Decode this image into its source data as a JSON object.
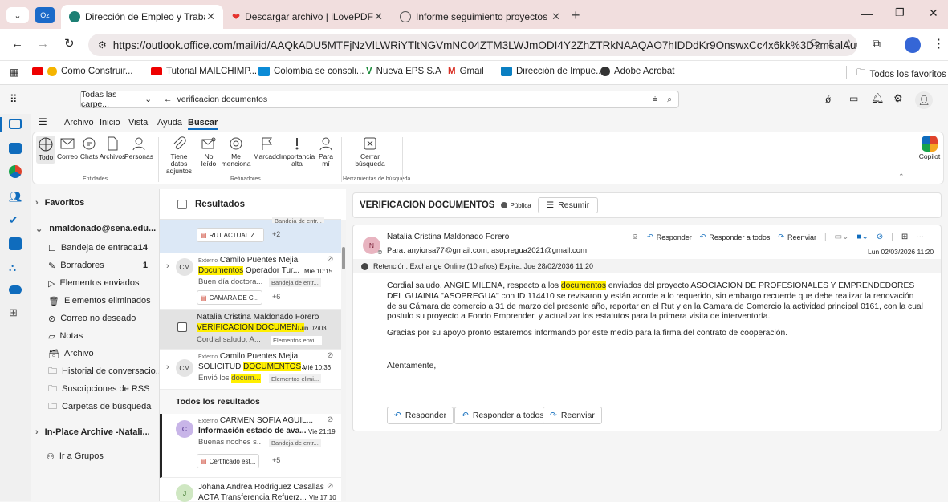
{
  "browser": {
    "tabs": [
      {
        "title": "Dirección de Empleo y Trabajo",
        "active": true
      },
      {
        "title": "Descargar archivo | iLovePDF",
        "active": false
      },
      {
        "title": "Informe seguimiento proyectos",
        "active": false
      }
    ],
    "url": "https://outlook.office.com/mail/id/AAQkADU5MTFjNzVlLWRiYTltNGVmNC04ZTM3LWJmODI4Y2ZhZTRkNAAQAO7hIDDdKr9OnswxCc4x6kk%3D?msalAuth...",
    "bookmarks": [
      "Como Construir...",
      "Tutorial MAILCHIMP...",
      "Colombia se consoli...",
      "Nueva EPS S.A",
      "Gmail",
      "Dirección de Impue...",
      "Adobe Acrobat"
    ],
    "all_bookmarks": "Todos los favoritos"
  },
  "search": {
    "scope": "Todas las carpe...",
    "query": "verificacion documentos"
  },
  "ribbon_tabs": [
    "Archivo",
    "Inicio",
    "Vista",
    "Ayuda",
    "Buscar"
  ],
  "ribbon": {
    "entidades": [
      "Todo",
      "Correo",
      "Chats",
      "Archivos",
      "Personas"
    ],
    "entidades_label": "Entidades",
    "refinadores": [
      {
        "l1": "Tiene datos",
        "l2": "adjuntos"
      },
      {
        "l1": "No",
        "l2": "leído"
      },
      {
        "l1": "Me",
        "l2": "menciona"
      },
      {
        "l1": "Marcado",
        "l2": ""
      },
      {
        "l1": "Importancia",
        "l2": "alta"
      },
      {
        "l1": "Para",
        "l2": "mí"
      }
    ],
    "refinadores_label": "Refinadores",
    "close_l1": "Cerrar",
    "close_l2": "búsqueda",
    "herramientas_label": "Herramientas de búsqueda",
    "copilot": "Copilot"
  },
  "folders": {
    "favoritos": "Favoritos",
    "account": "nmaldonado@sena.edu...",
    "items": [
      {
        "label": "Bandeja de entrada",
        "count": "14"
      },
      {
        "label": "Borradores",
        "count": "1"
      },
      {
        "label": "Elementos enviados",
        "count": ""
      },
      {
        "label": "Elementos eliminados",
        "count": ""
      },
      {
        "label": "Correo no deseado",
        "count": ""
      },
      {
        "label": "Notas",
        "count": ""
      },
      {
        "label": "Archivo",
        "count": ""
      },
      {
        "label": "Historial de conversacio...",
        "count": ""
      },
      {
        "label": "Suscripciones de RSS",
        "count": ""
      },
      {
        "label": "Carpetas de búsqueda",
        "count": ""
      }
    ],
    "archive": "In-Place Archive -Natali...",
    "groups": "Ir a Grupos"
  },
  "results": {
    "header": "Resultados",
    "partial_tag": "Bandeja de entr...",
    "first_chip": "RUT ACTUALIZ...",
    "first_more": "+2",
    "m1": {
      "initials": "CM",
      "externo": "Externo",
      "from": "Camilo Puentes Mejia",
      "subj_hl": "Documentos",
      "subj_rest": " Operador Tur...",
      "time": "Mié 10:15",
      "preview": "Buen día doctora...",
      "folder": "Bandeja de entr...",
      "chip": "CAMARA DE C...",
      "more": "+6"
    },
    "m2": {
      "from": "Natalia Cristina Maldonado Forero",
      "subj_hl": "VERIFICACION DOCUMEN...",
      "time": "Lun 02/03",
      "preview": "Cordial saludo, A...",
      "folder": "Elementos envi..."
    },
    "m3": {
      "initials": "CM",
      "externo": "Externo",
      "from": "Camilo Puentes Mejia",
      "subj_a": "SOLICITUD ",
      "subj_hl": "DOCUMENTOS",
      "subj_b": "...",
      "time": "Mié 10:36",
      "prev_a": "Envió los ",
      "prev_hl": "docum...",
      "folder": "Elementos elimi..."
    },
    "all_header": "Todos los resultados",
    "m4": {
      "initials": "C",
      "externo": "Externo",
      "from": "CARMEN SOFIA AGUIL...",
      "subject": "Información estado de ava...",
      "time": "Vie 21:19",
      "preview": "Buenas noches s...",
      "folder": "Bandeja de entr...",
      "chip": "Certificado est...",
      "more": "+5"
    },
    "m5": {
      "initials": "J",
      "from": "Johana Andrea Rodriguez Casallas",
      "subject": "ACTA Transferencia Refuerz...",
      "time": "Vie 17:10"
    }
  },
  "reading": {
    "subject": "VERIFICACION DOCUMENTOS",
    "public": "Pública",
    "summarize": "Resumir",
    "sender_initials": "N",
    "sender": "Natalia Cristina Maldonado Forero",
    "to_label": "Para:",
    "to": "anyiorsa77@gmail.com;  asopregua2021@gmail.com",
    "date": "Lun 02/03/2026 11:20",
    "reply": "Responder",
    "reply_all": "Responder a todos",
    "forward": "Reenviar",
    "retention": "Retención: Exchange Online (10 años) Expira: Jue 28/02/2036 11:20",
    "body_p1_a": "Cordial saludo, ANGIE MILENA, respecto a los ",
    "body_p1_hl": "documentos",
    "body_p1_b": " enviados  del proyecto ASOCIACION DE PROFESIONALES Y EMPRENDEDORES DEL GUAINIA \"ASOPREGUA\" con ID 114410 se revisaron  y están acorde a lo requerido, sin embargo recuerde que debe realizar la renovación de su Cámara de comercio a 31 de marzo del presente año,  reportar en el Rut y en la Camara de Comercio la actividad principal 0161, con la cual postulo su proyecto a Fondo Emprender,  y actualizar los estatutos para la primera visita de interventoría.",
    "body_p2": "Gracias por su apoyo pronto estaremos informando  por este medio para la firma del contrato de cooperación.",
    "signoff": "Atentamente,"
  },
  "colors": {
    "accent": "#0f6cbd",
    "highlight": "#ffef00",
    "tabstrip": "#f1dede"
  }
}
